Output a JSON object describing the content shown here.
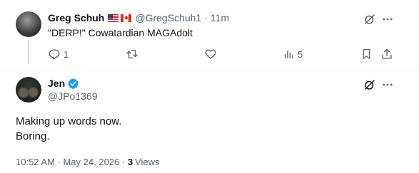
{
  "reply": {
    "author_name": "Greg Schuh",
    "flags": [
      "us-flag-icon",
      "canada-flag-icon"
    ],
    "handle": "@GregSchuh1",
    "separator": "·",
    "time": "11m",
    "text": "\"DERP!\" Cowatardian MAGAdolt",
    "actions": {
      "reply_count": "1",
      "retweet_count": "",
      "like_count": "",
      "views_count": "5"
    }
  },
  "main_tweet": {
    "author_name": "Jen",
    "verified": true,
    "handle": "@JPo1369",
    "text_lines": [
      "Making up words now.",
      "Boring."
    ],
    "timestamp": "10:52 AM · May 24, 2026 · ",
    "views_count": "3",
    "views_label": "Views"
  },
  "colors": {
    "text_primary": "#0f1419",
    "text_secondary": "#536471",
    "verified_blue": "#1d9bf0",
    "divider": "#eff3f4"
  }
}
